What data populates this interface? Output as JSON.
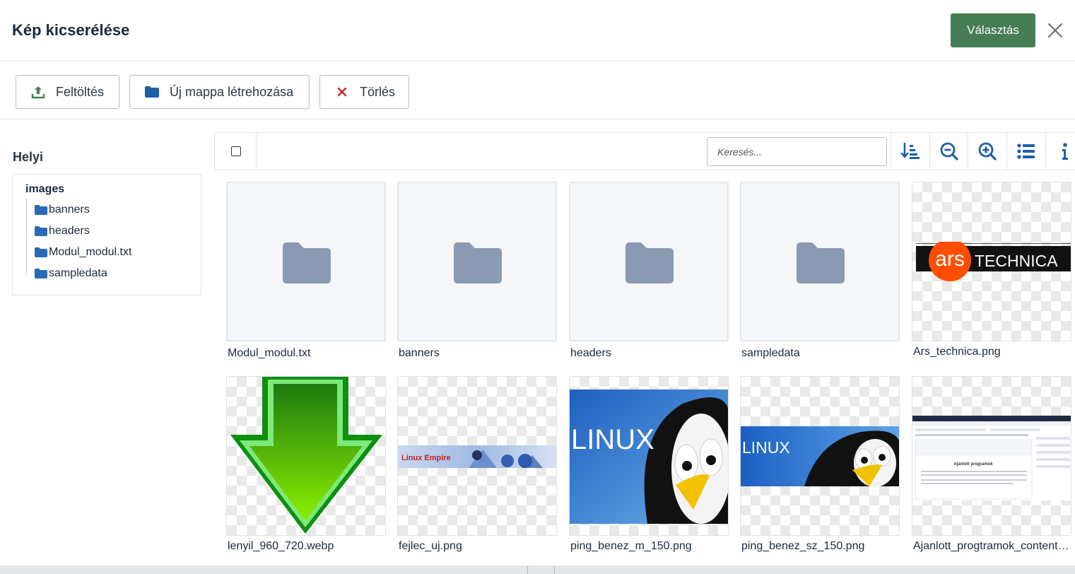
{
  "header": {
    "title": "Kép kicserélése",
    "select_label": "Választás"
  },
  "toolbar": {
    "upload_label": "Feltöltés",
    "new_folder_label": "Új mappa létrehozása",
    "delete_label": "Törlés"
  },
  "sidebar": {
    "title": "Helyi",
    "root": "images",
    "items": [
      {
        "label": "banners"
      },
      {
        "label": "headers"
      },
      {
        "label": "Modul_modul.txt"
      },
      {
        "label": "sampledata"
      }
    ]
  },
  "browser": {
    "search_placeholder": "Keresés..."
  },
  "items": [
    {
      "name": "Modul_modul.txt",
      "type": "folder"
    },
    {
      "name": "banners",
      "type": "folder"
    },
    {
      "name": "headers",
      "type": "folder"
    },
    {
      "name": "sampledata",
      "type": "folder"
    },
    {
      "name": "Ars_technica.png",
      "type": "image",
      "logo": {
        "ars": "ars",
        "technica": "TECHNICA"
      }
    },
    {
      "name": "lenyil_960_720.webp",
      "type": "image"
    },
    {
      "name": "fejlec_uj.png",
      "type": "image",
      "logo": {
        "text": "Linux Empire"
      }
    },
    {
      "name": "ping_benez_m_150.png",
      "type": "image",
      "logo": {
        "text": "LINUX"
      }
    },
    {
      "name": "ping_benez_sz_150.png",
      "type": "image",
      "logo": {
        "text": "LINUX"
      }
    },
    {
      "name": "Ajanlott_progtramok_content.png",
      "type": "image",
      "logo": {
        "text": "Ajánlott programok"
      }
    }
  ],
  "colors": {
    "primary": "#457d54",
    "folder": "#8a9ab2",
    "tree_folder": "#2a69b8",
    "delete": "#c62828",
    "upload": "#457d54",
    "icon": "#1e5fa8"
  }
}
